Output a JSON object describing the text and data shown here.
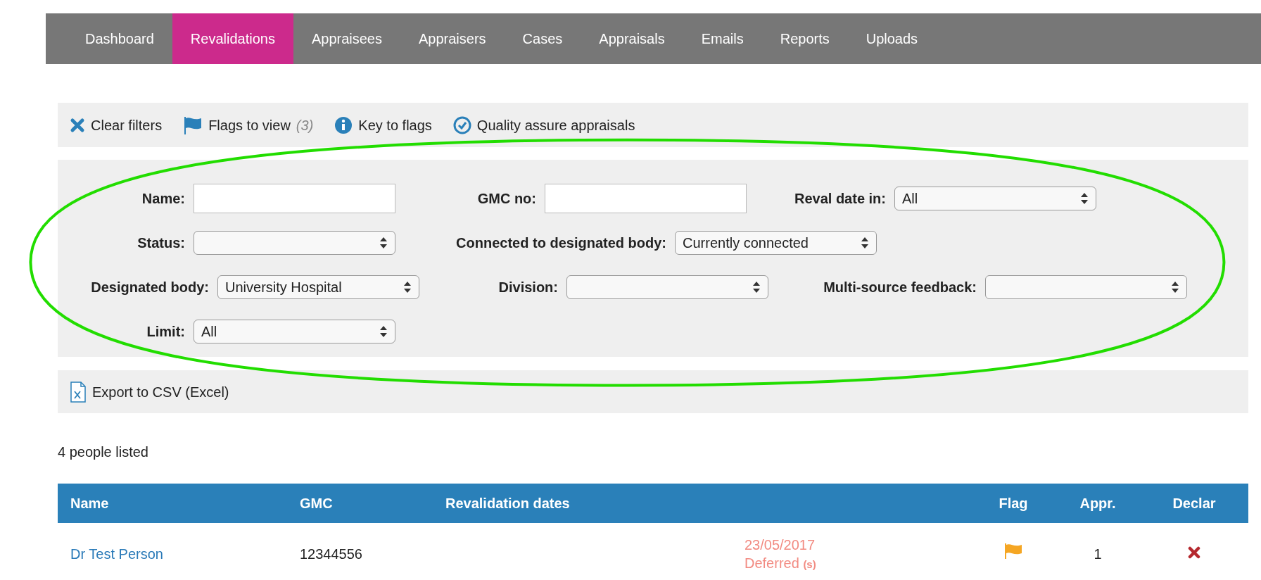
{
  "nav": {
    "tabs": [
      {
        "label": "Dashboard",
        "selected": false
      },
      {
        "label": "Revalidations",
        "selected": true
      },
      {
        "label": "Appraisees",
        "selected": false
      },
      {
        "label": "Appraisers",
        "selected": false
      },
      {
        "label": "Cases",
        "selected": false
      },
      {
        "label": "Appraisals",
        "selected": false
      },
      {
        "label": "Emails",
        "selected": false
      },
      {
        "label": "Reports",
        "selected": false
      },
      {
        "label": "Uploads",
        "selected": false
      }
    ]
  },
  "toolbar": [
    {
      "kind": "clear",
      "label": "Clear filters"
    },
    {
      "kind": "flags",
      "label": "Flags to view",
      "count": "(3)"
    },
    {
      "kind": "info",
      "label": "Key to flags"
    },
    {
      "kind": "check",
      "label": "Quality assure appraisals"
    }
  ],
  "filters": [
    [
      {
        "label": "Name:",
        "kind": "text"
      },
      {
        "label": "GMC no:",
        "kind": "text"
      },
      {
        "label": "Reval date in:",
        "kind": "select",
        "value": "All"
      }
    ],
    [
      {
        "label": "Status:",
        "kind": "select"
      },
      {
        "label": "Connected to designated body:",
        "kind": "select",
        "value": "Currently connected"
      }
    ],
    [
      {
        "label": "Designated body:",
        "kind": "select",
        "value": "University Hospital"
      },
      {
        "label": "Division:",
        "kind": "select"
      },
      {
        "label": "Multi-source feedback:",
        "kind": "select"
      }
    ],
    [
      {
        "label": "Limit:",
        "kind": "select",
        "value": "All"
      }
    ]
  ],
  "export": {
    "label": "Export to CSV (Excel)"
  },
  "summary": "4 people listed",
  "table": {
    "columns": [
      "Name",
      "GMC",
      "Revalidation dates",
      "Flag",
      "Appr.",
      "Declar"
    ],
    "rows": [
      {
        "name": "Dr Test Person",
        "gmc": "12344556",
        "reval_date": "23/05/2017",
        "reval_status": "Deferred",
        "reval_note": "(s)",
        "flagged": true,
        "appr": "1",
        "declared": false
      }
    ]
  }
}
